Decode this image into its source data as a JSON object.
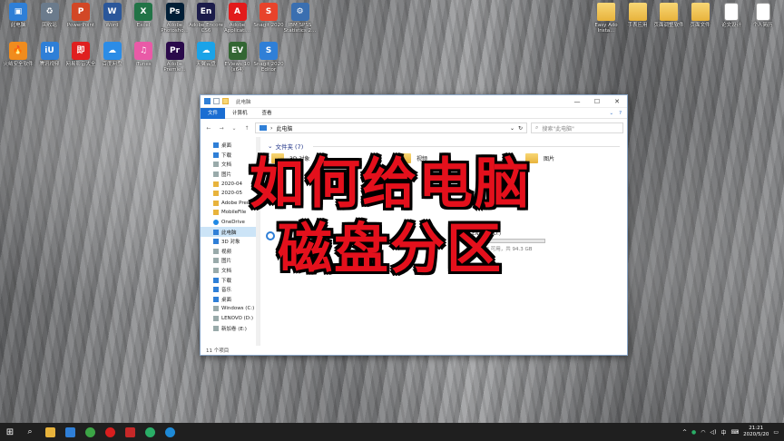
{
  "desktop_icons_row1_left": [
    {
      "label": "此电脑",
      "color": "#2f7fd7",
      "glyph": "▣"
    },
    {
      "label": "回收站",
      "color": "#6b7b8c",
      "glyph": "♻"
    },
    {
      "label": "PowerPoint",
      "color": "#d24726",
      "glyph": "P"
    },
    {
      "label": "Word",
      "color": "#2b579a",
      "glyph": "W"
    },
    {
      "label": "Excel",
      "color": "#217346",
      "glyph": "X"
    },
    {
      "label": "Adobe Photosho...",
      "color": "#001e36",
      "glyph": "Ps"
    },
    {
      "label": "Adobe Encore CS6",
      "color": "#1c1c4a",
      "glyph": "En"
    },
    {
      "label": "Adobe Applicati...",
      "color": "#e21b1b",
      "glyph": "A"
    },
    {
      "label": "Snagit 2020",
      "color": "#e8432b",
      "glyph": "S"
    },
    {
      "label": "IBM SPSS Statistics 2...",
      "color": "#3a6fb0",
      "glyph": "⚙"
    }
  ],
  "desktop_icons_row2_left": [
    {
      "label": "火绒安全软件",
      "color": "#f08c1e",
      "glyph": "🔥"
    },
    {
      "label": "腾讯视频",
      "color": "#2f7fd7",
      "glyph": "iU"
    },
    {
      "label": "网易影音大全",
      "color": "#e02020",
      "glyph": "即"
    },
    {
      "label": "百度网盘",
      "color": "#2b8ce6",
      "glyph": "☁"
    },
    {
      "label": "iTunes",
      "color": "#e95aa7",
      "glyph": "♫"
    },
    {
      "label": "Adobe Premie...",
      "color": "#2a0a4a",
      "glyph": "Pr"
    },
    {
      "label": "天翼云盘",
      "color": "#1aa3e8",
      "glyph": "☁"
    },
    {
      "label": "EViews 10 (x64)",
      "color": "#336633",
      "glyph": "EV"
    },
    {
      "label": "Snagit 2020 Editor",
      "color": "#2f7fd7",
      "glyph": "S"
    }
  ],
  "desktop_icons_right": [
    {
      "label": "Easy Ado Insta...",
      "type": "folder"
    },
    {
      "label": "手表应用",
      "type": "folder"
    },
    {
      "label": "页面调整软件",
      "type": "folder"
    },
    {
      "label": "页面文件",
      "type": "folder"
    },
    {
      "label": "论文设计",
      "type": "doc"
    },
    {
      "label": "个人简历",
      "type": "doc"
    }
  ],
  "explorer": {
    "title": "此电脑",
    "ribbon_tabs": [
      "文件",
      "计算机",
      "查看"
    ],
    "address": "此电脑",
    "search_placeholder": "搜索\"此电脑\"",
    "nav_items": [
      {
        "label": "桌面",
        "icon": "blue"
      },
      {
        "label": "下载",
        "icon": "blue"
      },
      {
        "label": "文档",
        "icon": "grey"
      },
      {
        "label": "图片",
        "icon": "grey"
      },
      {
        "label": "2020-04",
        "icon": "yel"
      },
      {
        "label": "2020-05",
        "icon": "yel"
      },
      {
        "label": "Adobe Prem",
        "icon": "yel"
      },
      {
        "label": "MobileFile",
        "icon": "yel"
      },
      {
        "label": "OneDrive",
        "icon": "cloud"
      },
      {
        "label": "此电脑",
        "icon": "blue",
        "selected": true
      },
      {
        "label": "3D 对象",
        "icon": "blue"
      },
      {
        "label": "视频",
        "icon": "grey"
      },
      {
        "label": "图片",
        "icon": "grey"
      },
      {
        "label": "文档",
        "icon": "grey"
      },
      {
        "label": "下载",
        "icon": "blue"
      },
      {
        "label": "音乐",
        "icon": "blue"
      },
      {
        "label": "桌面",
        "icon": "blue"
      },
      {
        "label": "Windows (C:)",
        "icon": "grey"
      },
      {
        "label": "LENOVO (D:)",
        "icon": "grey"
      },
      {
        "label": "新加卷 (E:)",
        "icon": "grey"
      }
    ],
    "group_header": "文件夹 (7)",
    "folders": [
      "3D 对象",
      "视频",
      "图片"
    ],
    "drive": {
      "name": "LENOVO (D:)",
      "detail": "81.8 GB 可用，共 94.3 GB",
      "used_fraction": 0.13
    },
    "status": "11 个项目"
  },
  "overlay": {
    "line1": "如何给电脑",
    "line2": "磁盘分区"
  },
  "taskbar": {
    "time": "21:21",
    "date": "2020/5/20",
    "ime": "中"
  }
}
